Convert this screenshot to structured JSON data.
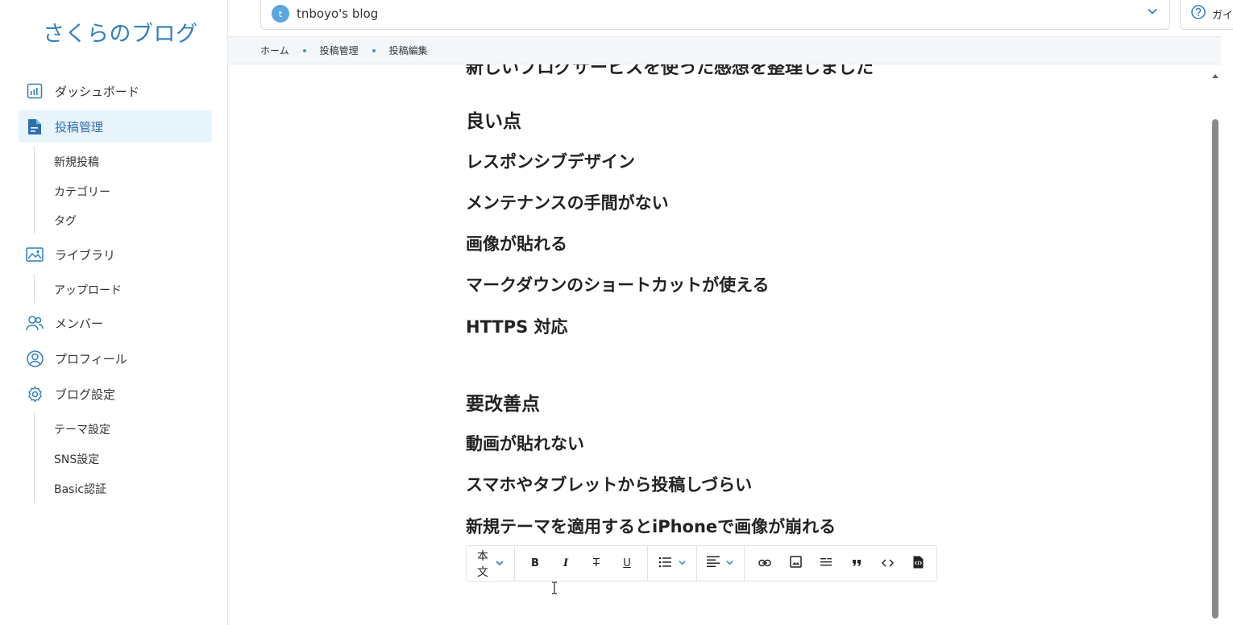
{
  "sidebar": {
    "logo": "さくらのブログ",
    "items": {
      "dashboard": "ダッシュボード",
      "posts": "投稿管理",
      "new_post": "新規投稿",
      "category": "カテゴリー",
      "tag": "タグ",
      "library": "ライブラリ",
      "upload": "アップロード",
      "members": "メンバー",
      "profile": "プロフィール",
      "blog_settings": "ブログ設定",
      "theme": "テーマ設定",
      "sns": "SNS設定",
      "basic_auth": "Basic認証"
    }
  },
  "header": {
    "blog_initial": "t",
    "blog_name": "tnboyo's blog",
    "guide_label": "ガイド"
  },
  "breadcrumb": [
    "ホーム",
    "投稿管理",
    "投稿編集"
  ],
  "editor": {
    "cut_line": "新しいブログサービスを使った感想を整理しました",
    "good_heading": "良い点",
    "good_items": [
      "レスポンシブデザイン",
      "メンテナンスの手間がない",
      "画像が貼れる",
      "マークダウンのショートカットが使える",
      "HTTPS 対応"
    ],
    "bad_heading": "要改善点",
    "bad_items": [
      "動画が貼れない",
      "スマホやタブレットから投稿しづらい",
      "新規テーマを適用するとiPhoneで画像が崩れる"
    ]
  },
  "toolbar": {
    "style_label": "本文",
    "bold": "B",
    "italic": "I",
    "strike": "T",
    "underline": "U"
  },
  "colors": {
    "accent": "#2f7fc1",
    "active_bg": "#e8f4fc",
    "breadcrumb_bg": "#f4f7fa"
  }
}
